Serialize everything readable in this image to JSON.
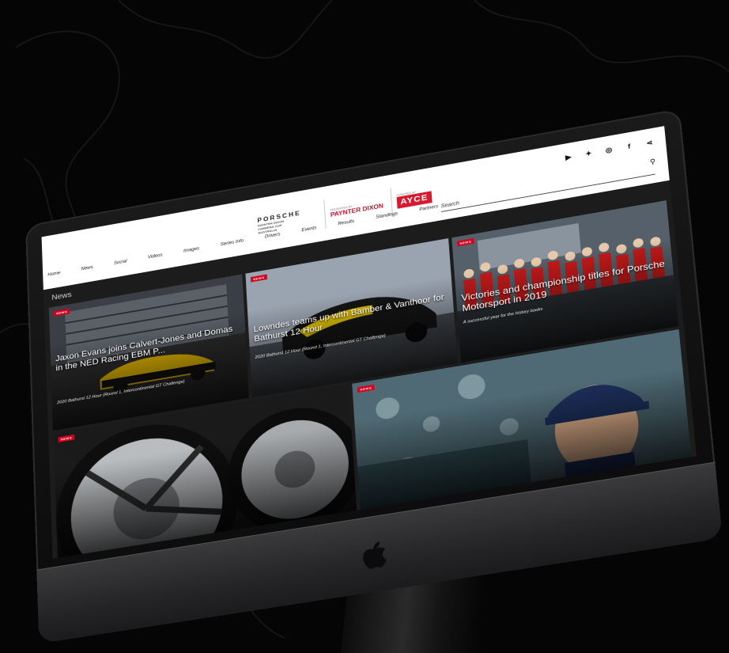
{
  "site": {
    "logos": {
      "porsche_wordmark": "PORSCHE",
      "porsche_sub": [
        "PAYNTER DIXON",
        "CARRERA CUP",
        "AUSTRALIA"
      ],
      "paynter_pre": "PRESENTED BY",
      "paynter_name": "PAYNTER DIXON",
      "ayce_pre": "POWERED BY",
      "ayce_name": "AYCE"
    },
    "nav": [
      "Home",
      "News",
      "Social",
      "Videos",
      "Images",
      "Series Info",
      "Drivers",
      "Events",
      "Results",
      "Standings",
      "Partners"
    ],
    "search_placeholder": "Search",
    "socials": [
      "youtube-icon",
      "twitter-icon",
      "instagram-icon",
      "facebook-icon",
      "share-icon"
    ]
  },
  "news": {
    "heading": "News",
    "badge_label": "NEWS",
    "cards": [
      {
        "title": "Jaxon Evans joins Calvert-Jones and Domas in the NED Racing EBM P...",
        "subtitle": "2020 Bathurst 12 Hour (Round 1, Intercontinental GT Challenge)"
      },
      {
        "title": "Lowndes teams up with Bamber & Vanthoor for Bathurst 12 Hour",
        "subtitle": "2020 Bathurst 12 Hour (Round 1, Intercontinental GT Challenge)"
      },
      {
        "title": "Victories and championship titles for Porsche Motorsport in 2019",
        "subtitle": "A successful year for the history books"
      },
      {
        "title": "",
        "subtitle": ""
      },
      {
        "title": "",
        "subtitle": ""
      }
    ]
  },
  "colors": {
    "badge": "#d5001c",
    "ayce": "#d5192f",
    "paynter": "#c8102e"
  }
}
